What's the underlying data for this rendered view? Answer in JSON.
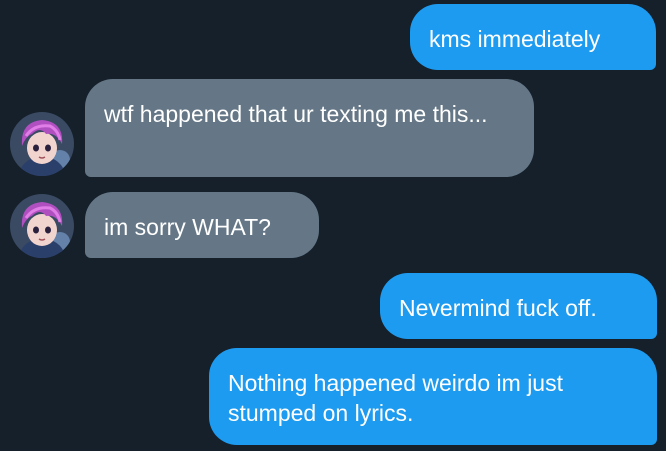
{
  "conversation": {
    "messages": [
      {
        "direction": "sent",
        "text": "kms immediately"
      },
      {
        "direction": "received",
        "text": "wtf happened that ur texting me this..."
      },
      {
        "direction": "received",
        "text": "im sorry WHAT?"
      },
      {
        "direction": "sent",
        "text": "Nevermind fuck off."
      },
      {
        "direction": "sent",
        "text": "Nothing happened weirdo im just stumped on lyrics."
      }
    ],
    "contact_avatar_icon": "anime-girl-purple-hair-avatar-icon"
  },
  "colors": {
    "background": "#15202b",
    "sent_bubble": "#1d9bf0",
    "received_bubble": "#657786",
    "text": "#ffffff"
  }
}
